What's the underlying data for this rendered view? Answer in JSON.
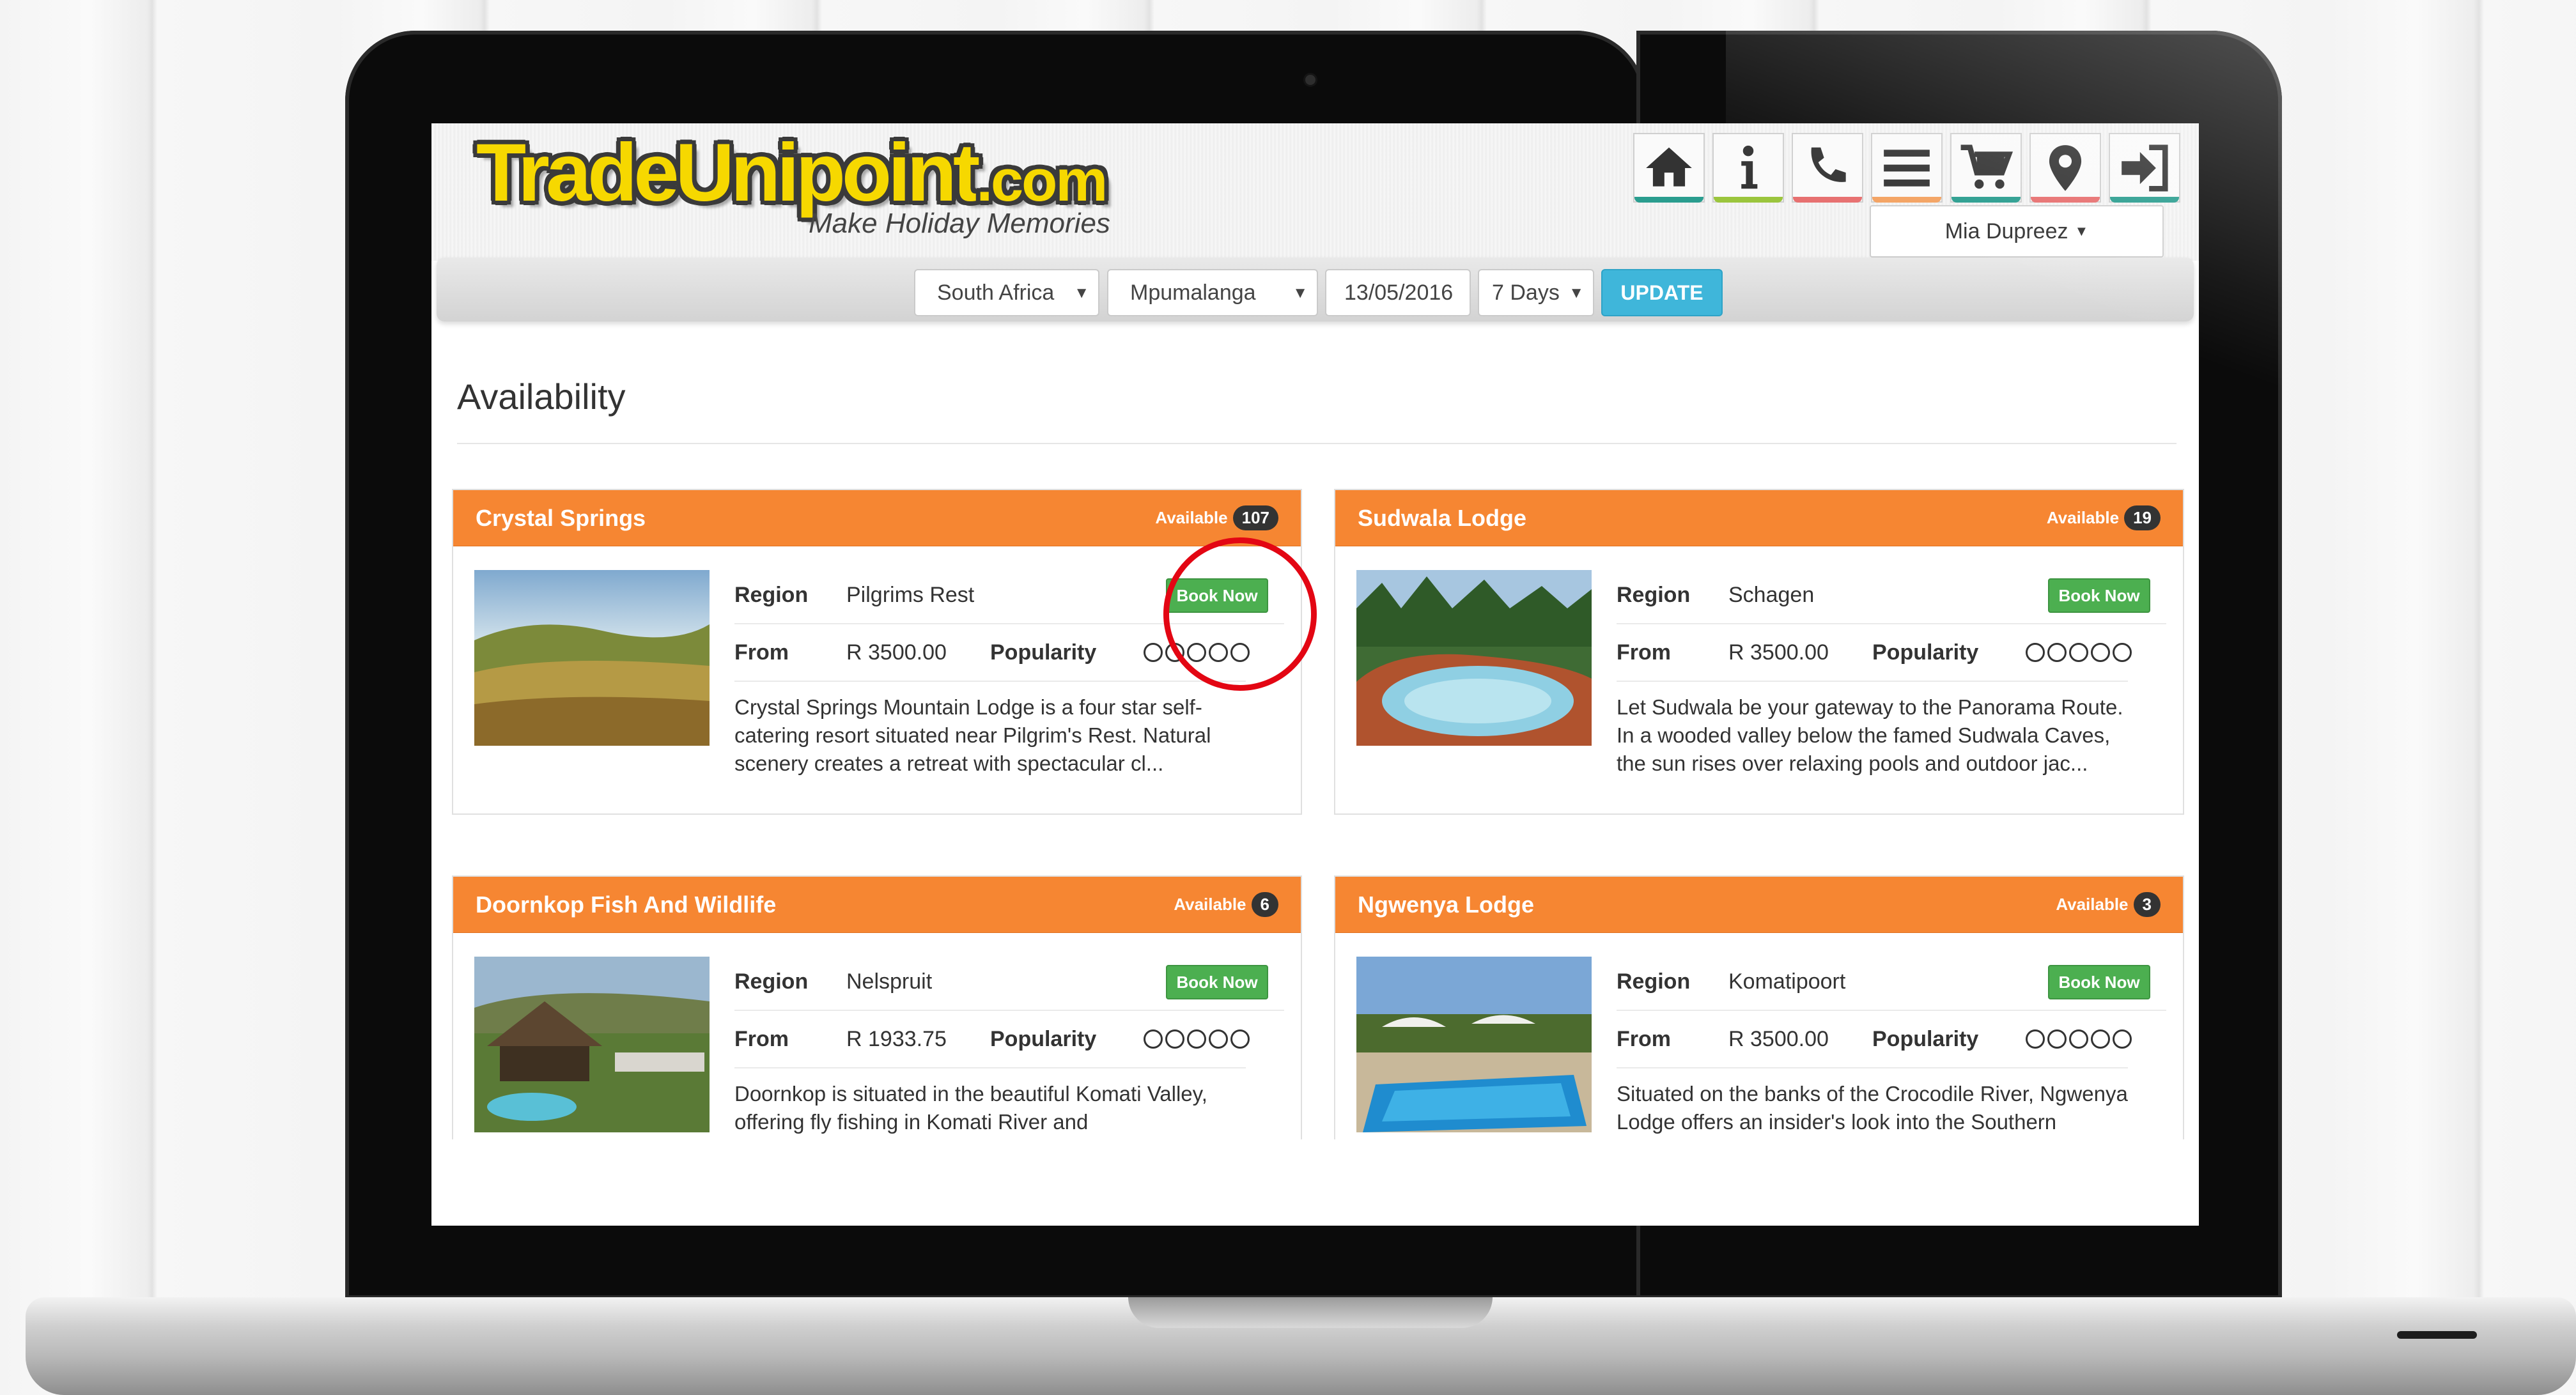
{
  "brand": {
    "logo_main": "TradeUnipoint",
    "logo_suffix": ".com",
    "tagline": "Make Holiday Memories"
  },
  "nav_icons": [
    {
      "icon": "home-icon",
      "accent": "#2a9d8f"
    },
    {
      "icon": "info-icon",
      "accent": "#9bc53d"
    },
    {
      "icon": "phone-icon",
      "accent": "#e76f6f"
    },
    {
      "icon": "menu-icon",
      "accent": "#f4a261"
    },
    {
      "icon": "cart-icon",
      "accent": "#2a9d8f"
    },
    {
      "icon": "location-pin-icon",
      "accent": "#e76f6f"
    },
    {
      "icon": "login-icon",
      "accent": "#2a9d8f"
    }
  ],
  "user": {
    "name": "Mia Dupreez"
  },
  "filters": {
    "country": "South Africa",
    "province": "Mpumalanga",
    "date": "13/05/2016",
    "duration": "7 Days",
    "update_label": "UPDATE"
  },
  "page_title": "Availability",
  "labels": {
    "available": "Available",
    "region": "Region",
    "from": "From",
    "popularity": "Popularity",
    "book_now": "Book Now"
  },
  "lodges": [
    {
      "name": "Crystal Springs",
      "available": "107",
      "region": "Pilgrims Rest",
      "from": "R 3500.00",
      "description": "Crystal Springs Mountain Lodge is a four star self-catering resort situated near Pilgrim's Rest. Natural scenery creates a retreat with spectacular cl..."
    },
    {
      "name": "Sudwala Lodge",
      "available": "19",
      "region": "Schagen",
      "from": "R 3500.00",
      "description": "Let Sudwala be your gateway to the Panorama Route. In a wooded valley below the famed Sudwala Caves, the sun rises over relaxing pools and outdoor jac..."
    },
    {
      "name": "Doornkop Fish And Wildlife",
      "available": "6",
      "region": "Nelspruit",
      "from": "R 1933.75",
      "description": "Doornkop is situated in the beautiful Komati Valley, offering fly fishing in Komati River and Swartwaterspruit."
    },
    {
      "name": "Ngwenya Lodge",
      "available": "3",
      "region": "Komatipoort",
      "from": "R 3500.00",
      "description": "Situated on the banks of the Crocodile River, Ngwenya Lodge offers an insider's look into the Southern boundary"
    }
  ],
  "colors": {
    "card_header": "#f68632",
    "book_button": "#4caf50",
    "update_button": "#3fb6da",
    "highlight_circle": "#e30613"
  }
}
